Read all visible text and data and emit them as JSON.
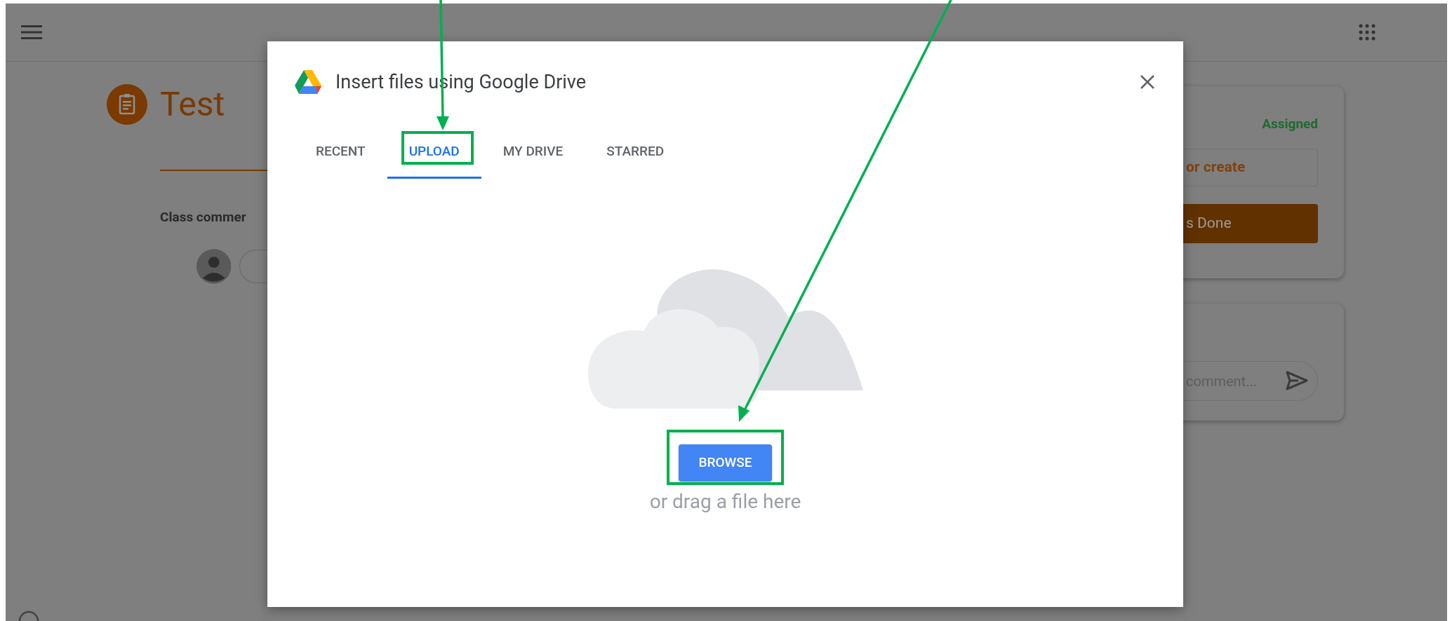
{
  "background_page": {
    "title": "Test",
    "class_comments_label": "Class commer",
    "status": "Assigned",
    "add_button": "or create",
    "done_button": "s Done",
    "comment_placeholder": "comment..."
  },
  "dialog": {
    "title": "Insert files using Google Drive",
    "tabs": [
      {
        "label": "RECENT",
        "selected": false
      },
      {
        "label": "UPLOAD",
        "selected": true
      },
      {
        "label": "MY DRIVE",
        "selected": false
      },
      {
        "label": "STARRED",
        "selected": false
      }
    ],
    "browse_button": "BROWSE",
    "drop_hint": "or drag a file here"
  }
}
